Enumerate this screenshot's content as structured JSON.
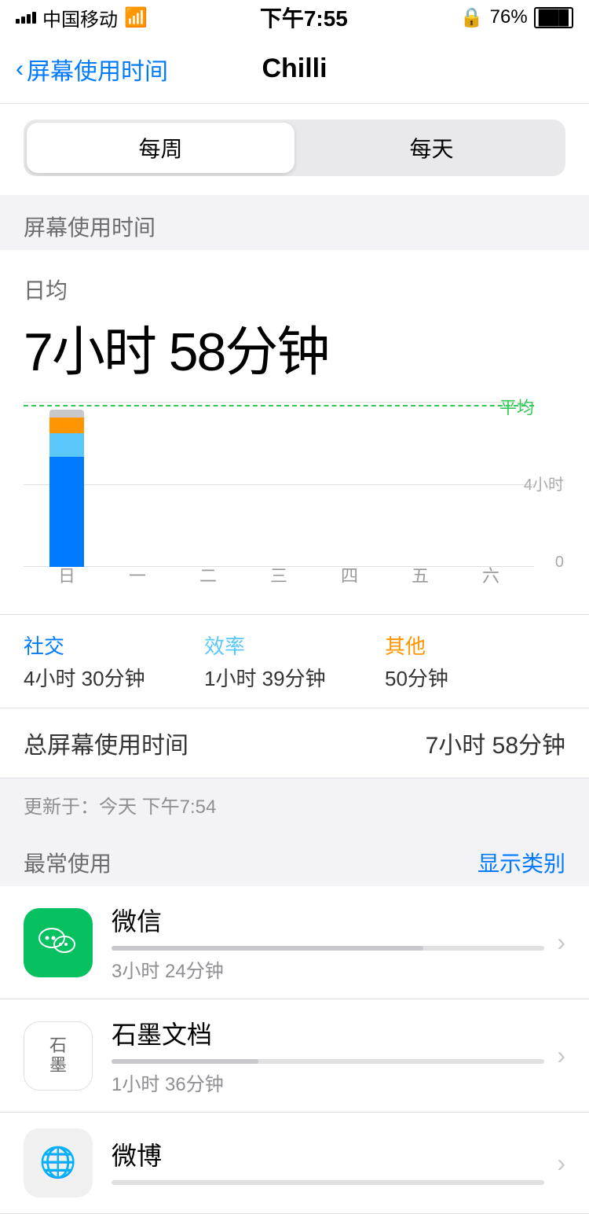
{
  "statusBar": {
    "carrier": "中国移动",
    "time": "下午7:55",
    "battery": "76%",
    "wifi": true
  },
  "navBar": {
    "backText": "屏幕使用时间",
    "title": "Chilli"
  },
  "segmentControl": {
    "options": [
      "每周",
      "每天"
    ],
    "activeIndex": 0
  },
  "sectionLabel": "屏幕使用时间",
  "chart": {
    "dailyLabel": "日均",
    "dailyTime": "7小时 58分钟",
    "avgLabel": "平均",
    "yLabels": [
      "4小时",
      "0"
    ],
    "days": [
      "日",
      "一",
      "二",
      "三",
      "四",
      "五",
      "六"
    ],
    "bars": [
      {
        "blue": 140,
        "cyan": 30,
        "orange": 20,
        "gray": 10
      },
      {
        "blue": 0,
        "cyan": 0,
        "orange": 0,
        "gray": 0
      },
      {
        "blue": 0,
        "cyan": 0,
        "orange": 0,
        "gray": 0
      },
      {
        "blue": 0,
        "cyan": 0,
        "orange": 0,
        "gray": 0
      },
      {
        "blue": 0,
        "cyan": 0,
        "orange": 0,
        "gray": 0
      },
      {
        "blue": 0,
        "cyan": 0,
        "orange": 0,
        "gray": 0
      },
      {
        "blue": 0,
        "cyan": 0,
        "orange": 0,
        "gray": 0
      }
    ],
    "avgLineTopPercent": 2
  },
  "categories": [
    {
      "name": "社交",
      "color": "blue",
      "time": "4小时 30分钟"
    },
    {
      "name": "效率",
      "color": "cyan",
      "time": "1小时 39分钟"
    },
    {
      "name": "其他",
      "color": "orange",
      "time": "50分钟"
    }
  ],
  "totalRow": {
    "label": "总屏幕使用时间",
    "value": "7小时 58分钟"
  },
  "updateInfo": "更新于：今天 下午7:54",
  "mostUsed": {
    "label": "最常使用",
    "showCategoryLabel": "显示类别"
  },
  "apps": [
    {
      "name": "微信",
      "iconType": "wechat",
      "iconText": "WeChat",
      "time": "3小时 24分钟",
      "barWidth": "72%"
    },
    {
      "name": "石墨文档",
      "iconType": "shimo",
      "iconText": "石墨",
      "time": "1小时 36分钟",
      "barWidth": "34%"
    },
    {
      "name": "微博",
      "iconType": "weibo",
      "iconText": "微博",
      "time": "",
      "barWidth": "0%"
    }
  ]
}
